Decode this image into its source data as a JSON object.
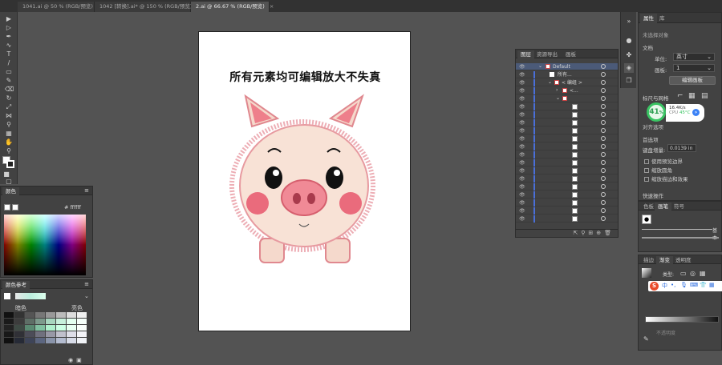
{
  "tabs": [
    {
      "label": "1041.ai @ 50 % (RGB/预览)"
    },
    {
      "label": "1042 [转换].ai* @ 150 % (RGB/预览)"
    },
    {
      "label": "2.ai @ 66.67 % (RGB/预览)"
    }
  ],
  "artboard": {
    "headline": "所有元素均可编辑放大不失真"
  },
  "layers_panel": {
    "tabs": [
      "图层",
      "资源导出",
      "画板"
    ],
    "rows": [
      {
        "name": "Default"
      },
      {
        "name": "所有..."
      },
      {
        "name": "< 编组 >"
      },
      {
        "name": "<..."
      },
      {
        "name": ""
      }
    ]
  },
  "color_panel": {
    "title": "颜色",
    "hex_prefix": "#",
    "hex_value": "ffffff"
  },
  "color_guide_panel": {
    "title": "颜色参考",
    "left_label": "暗色",
    "right_label": "亮色"
  },
  "properties_panel": {
    "tabs": [
      "属性",
      "库"
    ],
    "no_selection": "未选择对象",
    "document_label": "文档",
    "unit_label": "单位:",
    "unit_value": "英寸",
    "artboard_label": "画板:",
    "artboard_value": "1",
    "edit_artboards_button": "编辑画板",
    "rulers_grid_label": "标尺与网格",
    "align_label": "对齐选项",
    "preferences_label": "首选项",
    "keyboard_increment_label": "键盘增量:",
    "keyboard_increment_value": "0.0139 in",
    "preview_bounds_label": "使用预览边界",
    "scale_corners_label": "缩放圆角",
    "scale_strokes_label": "缩放描边和效果",
    "quick_actions_label": "快速操作"
  },
  "performance_widget": {
    "percent": "41",
    "percent_unit": "%",
    "net_speed": "16.4K/s",
    "cpu_label": "CPU",
    "cpu_temp": "45°C"
  },
  "brushes_panel": {
    "tabs": [
      "色板",
      "画笔",
      "符号"
    ],
    "basic_label": "基本"
  },
  "gradient_panel": {
    "tabs": [
      "描边",
      "渐变",
      "透明度"
    ],
    "type_label": "类型:",
    "opacity_label": "不透明度"
  },
  "ime_bar": {
    "logo": "S",
    "lang": "中"
  }
}
